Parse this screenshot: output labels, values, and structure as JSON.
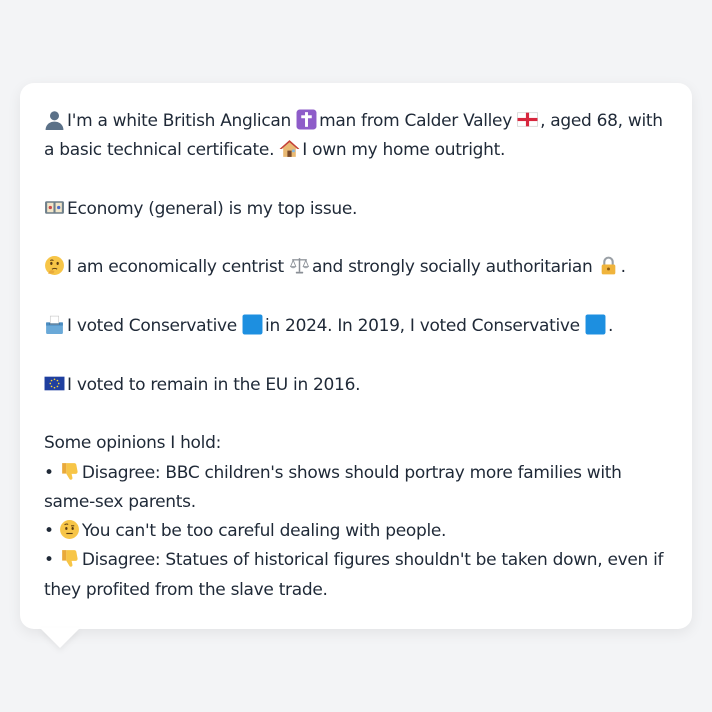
{
  "profile": {
    "intro_part1": "I'm a white British Anglican",
    "intro_part2": "man from Calder Valley",
    "intro_part3": ", aged 68, with",
    "intro_line2": "a basic technical certificate.",
    "intro_home": "I own my home outright.",
    "issue": "Economy (general) is my top issue.",
    "ideology_part1": "I am economically centrist",
    "ideology_part2": "and strongly socially authoritarian",
    "ideology_end": ".",
    "vote_part1": "I voted Conservative",
    "vote_part2": "in 2024. In 2019, I voted Conservative",
    "vote_end": ".",
    "eu": "I voted to remain in the EU in 2016.",
    "opinions_heading": "Some opinions I hold:",
    "bullet": "•",
    "opinion1_line1": "Disagree: BBC children's shows should portray more families with",
    "opinion1_line2": "same-sex parents.",
    "opinion2": "You can't be too careful dealing with people.",
    "opinion3_line1": "Disagree: Statues of historical figures shouldn't be taken down, even if",
    "opinion3_line2": "they profited from the slave trade."
  },
  "icons": {
    "person": "person-silhouette-icon",
    "cross": "latin-cross-icon",
    "flag": "england-flag-icon",
    "home": "house-icon",
    "money": "banknotes-icon",
    "thinking": "thinking-face-icon",
    "scales": "balance-scale-icon",
    "lock": "padlock-icon",
    "ballot": "ballot-box-icon",
    "blue_square": "blue-square-icon",
    "eu_flag": "eu-flag-icon",
    "thumbs_down": "thumbs-down-icon",
    "raised_eyebrow": "raised-eyebrow-face-icon"
  },
  "colors": {
    "background": "#f3f4f6",
    "bubble": "#ffffff",
    "text": "#1f2937",
    "conservative_blue": "#1d8fe0"
  }
}
